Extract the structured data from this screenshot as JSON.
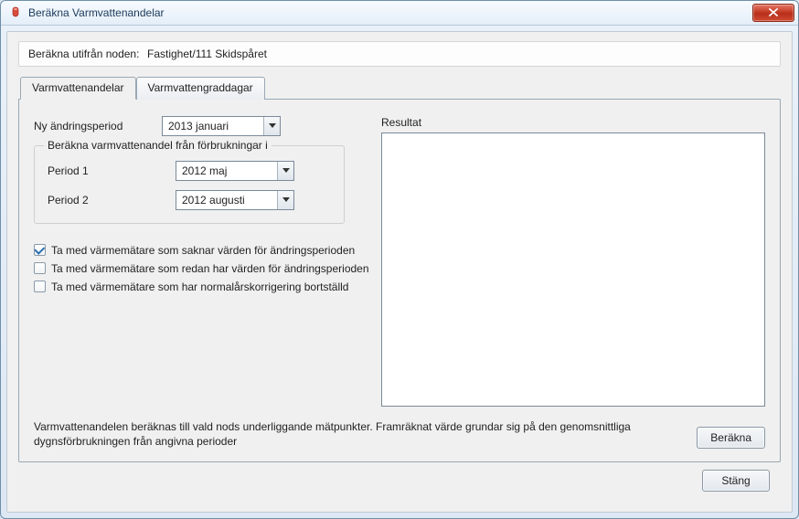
{
  "window": {
    "title": "Beräkna Varmvattenandelar"
  },
  "node": {
    "label": "Beräkna utifrån noden:",
    "value": "Fastighet/111 Skidspåret"
  },
  "tabs": [
    {
      "label": "Varmvattenandelar",
      "active": true
    },
    {
      "label": "Varmvattengraddagar",
      "active": false
    }
  ],
  "fields": {
    "new_period_label": "Ny ändringsperiod",
    "new_period_value": "2013 januari",
    "group_legend": "Beräkna varmvattenandel från förbrukningar i",
    "period1_label": "Period 1",
    "period1_value": "2012 maj",
    "period2_label": "Period 2",
    "period2_value": "2012 augusti"
  },
  "checkboxes": [
    {
      "label": "Ta med värmemätare som saknar värden för ändringsperioden",
      "checked": true
    },
    {
      "label": "Ta med värmemätare som redan har värden för ändringsperioden",
      "checked": false
    },
    {
      "label": "Ta med värmemätare som har normalårskorrigering bortställd",
      "checked": false
    }
  ],
  "result_label": "Resultat",
  "description": "Varmvattenandelen beräknas till vald nods underliggande mätpunkter. Framräknat värde grundar sig på den genomsnittliga dygnsförbrukningen från angivna perioder",
  "buttons": {
    "calculate": "Beräkna",
    "close": "Stäng"
  }
}
